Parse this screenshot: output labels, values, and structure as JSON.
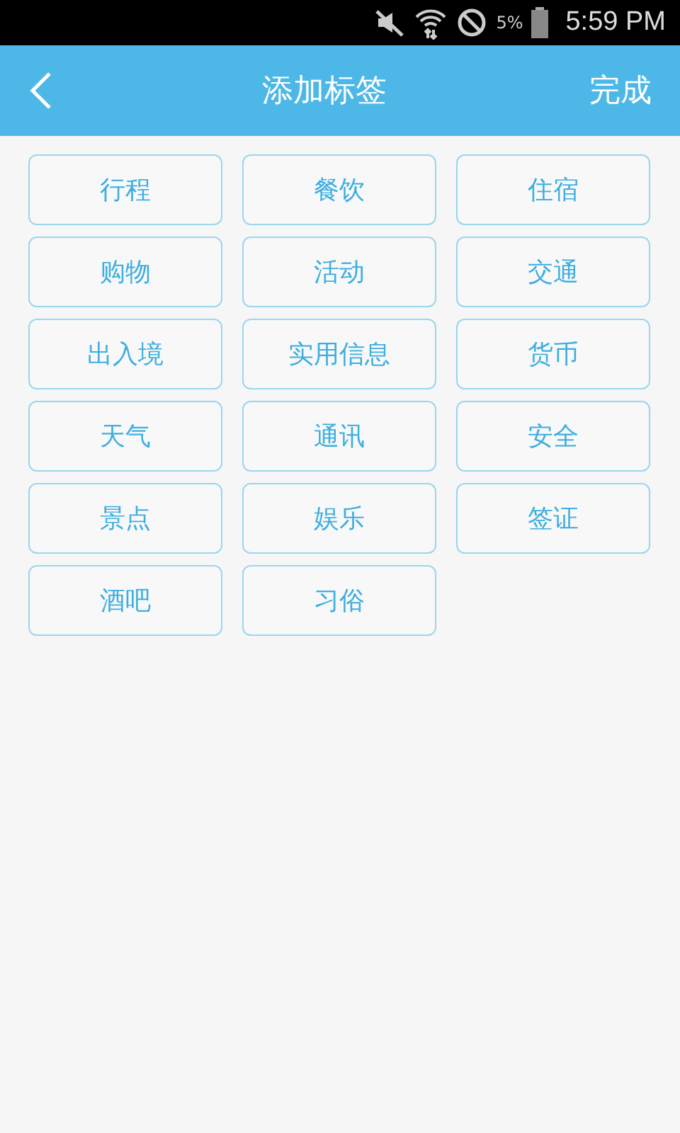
{
  "status_bar": {
    "battery": "5%",
    "time": "5:59 PM"
  },
  "header": {
    "title": "添加标签",
    "action": "完成"
  },
  "tags": [
    {
      "label": "行程"
    },
    {
      "label": "餐饮"
    },
    {
      "label": "住宿"
    },
    {
      "label": "购物"
    },
    {
      "label": "活动"
    },
    {
      "label": "交通"
    },
    {
      "label": "出入境"
    },
    {
      "label": "实用信息"
    },
    {
      "label": "货币"
    },
    {
      "label": "天气"
    },
    {
      "label": "通讯"
    },
    {
      "label": "安全"
    },
    {
      "label": "景点"
    },
    {
      "label": "娱乐"
    },
    {
      "label": "签证"
    },
    {
      "label": "酒吧"
    },
    {
      "label": "习俗"
    }
  ]
}
